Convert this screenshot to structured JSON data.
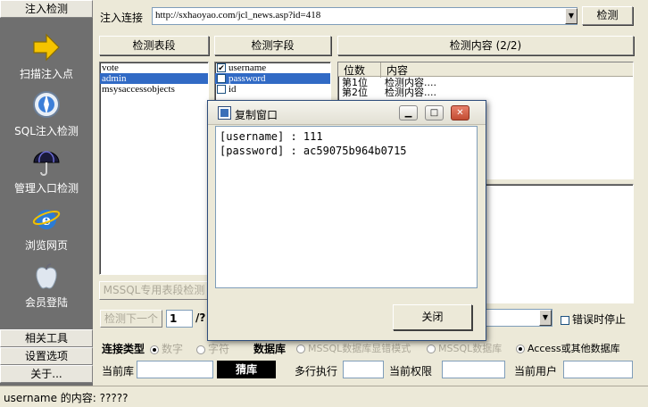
{
  "sidebar": {
    "top_button": "注入检测",
    "items": [
      {
        "label": "扫描注入点",
        "icon": "arrow-right-icon"
      },
      {
        "label": "SQL注入检测",
        "icon": "compass-icon"
      },
      {
        "label": "管理入口检测",
        "icon": "umbrella-icon"
      },
      {
        "label": "浏览网页",
        "icon": "ie-icon"
      },
      {
        "label": "会员登陆",
        "icon": "apple-icon"
      }
    ],
    "bottom_buttons": [
      "相关工具",
      "设置选项",
      "关于..."
    ]
  },
  "toolbar": {
    "url_label": "注入连接",
    "url_value": "http://sxhaoyao.com/jcl_news.asp?id=418",
    "detect_button": "检测"
  },
  "panels": {
    "tables_header": "检测表段",
    "fields_header": "检测字段",
    "content_header": "检测内容 (2/2)",
    "tables": [
      "vote",
      "admin",
      "msysaccessobjects"
    ],
    "selected_table": "admin",
    "fields": [
      {
        "name": "username",
        "checked": true
      },
      {
        "name": "password",
        "checked": true
      },
      {
        "name": "id",
        "checked": false
      }
    ],
    "content_columns": [
      "位数",
      "内容"
    ],
    "content_rows": [
      [
        "第1位",
        "检测内容...."
      ],
      [
        "第2位",
        "检测内容...."
      ]
    ],
    "mssql_button": "MSSQL专用表段检测"
  },
  "controls": {
    "detect_next": "检测下一个",
    "page_value": "1",
    "page_suffix": "/?",
    "error_stop": "错误时停止"
  },
  "conn": {
    "type_label": "连接类型",
    "opt_number": "数字",
    "opt_char": "字符",
    "db_label": "数据库",
    "db_opt1": "MSSQL数据库显错模式",
    "db_opt2": "MSSQL数据库",
    "db_opt3": "Access或其他数据库"
  },
  "info": {
    "current_db": "当前库",
    "black_btn": "猜库",
    "multi_exec": "多行执行",
    "current_perm": "当前权限",
    "current_user": "当前用户"
  },
  "status": "username 的内容: ?????",
  "dialog": {
    "title": "复制窗口",
    "lines": [
      "[username] : 111",
      "[password] : ac59075b964b0715"
    ],
    "close_button": "关闭"
  }
}
